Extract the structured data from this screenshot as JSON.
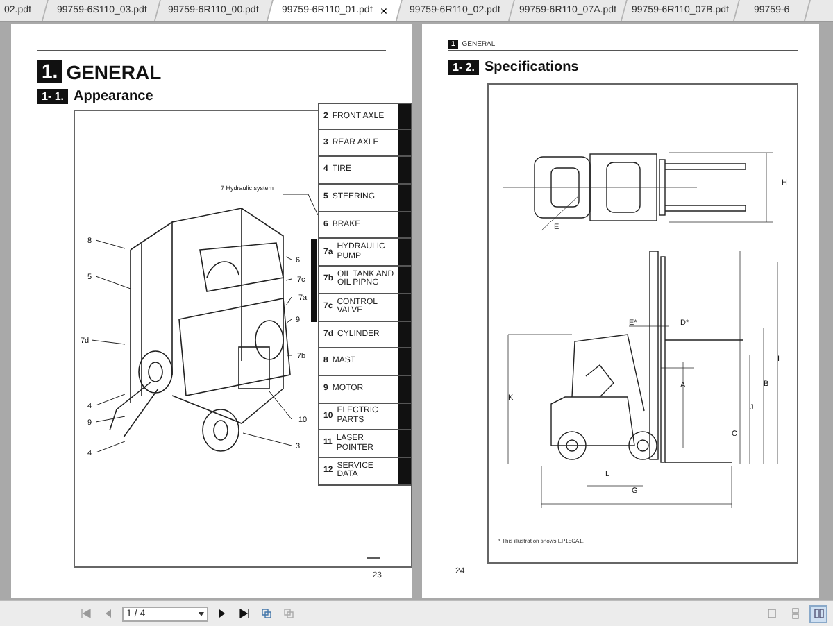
{
  "tabs": [
    {
      "label": "02.pdf",
      "selected": false,
      "closable": false
    },
    {
      "label": "99759-6S110_03.pdf",
      "selected": false,
      "closable": false
    },
    {
      "label": "99759-6R110_00.pdf",
      "selected": false,
      "closable": false
    },
    {
      "label": "99759-6R110_01.pdf",
      "selected": true,
      "closable": true
    },
    {
      "label": "99759-6R110_02.pdf",
      "selected": false,
      "closable": false
    },
    {
      "label": "99759-6R110_07A.pdf",
      "selected": false,
      "closable": false
    },
    {
      "label": "99759-6R110_07B.pdf",
      "selected": false,
      "closable": false
    },
    {
      "label": "99759-6",
      "selected": false,
      "closable": false
    }
  ],
  "tab_close": "×",
  "left_page": {
    "chapter": {
      "number": "1.",
      "title": "GENERAL"
    },
    "section": {
      "number": "1- 1.",
      "title": "Appearance"
    },
    "figure": {
      "system_label": "7 Hydraulic system",
      "callouts": [
        "8",
        "5",
        "7d",
        "4",
        "9",
        "4",
        "6",
        "7c",
        "7a",
        "9",
        "7b",
        "10",
        "3"
      ]
    },
    "index_tabs": [
      {
        "number": "2",
        "label": "FRONT AXLE",
        "marked": false
      },
      {
        "number": "3",
        "label": "REAR AXLE",
        "marked": false
      },
      {
        "number": "4",
        "label": "TIRE",
        "marked": false
      },
      {
        "number": "5",
        "label": "STEERING",
        "marked": false
      },
      {
        "number": "6",
        "label": "BRAKE",
        "marked": false
      },
      {
        "number": "7a",
        "label": "HYDRAULIC PUMP",
        "marked": true
      },
      {
        "number": "7b",
        "label": "OIL TANK AND OIL PIPNG",
        "marked": true
      },
      {
        "number": "7c",
        "label": "CONTROL VALVE",
        "marked": true
      },
      {
        "number": "7d",
        "label": "CYLINDER",
        "marked": false
      },
      {
        "number": "8",
        "label": "MAST",
        "marked": false
      },
      {
        "number": "9",
        "label": "MOTOR",
        "marked": false
      },
      {
        "number": "10",
        "label": "ELECTRIC PARTS",
        "marked": false
      },
      {
        "number": "11",
        "label": "LASER POINTER",
        "marked": false
      },
      {
        "number": "12",
        "label": "SERVICE DATA",
        "marked": false
      }
    ],
    "page_number": "23"
  },
  "right_page": {
    "header": {
      "number": "1",
      "title": "GENERAL"
    },
    "section": {
      "number": "1- 2.",
      "title": "Specifications"
    },
    "figure": {
      "dimension_labels": [
        "H",
        "E",
        "E*",
        "D*",
        "A",
        "K",
        "J",
        "B",
        "I",
        "C",
        "L",
        "G"
      ],
      "footnote": "* This illustration shows EP15CA1."
    },
    "page_number": "24"
  },
  "toolbar": {
    "page_field": "1 / 4",
    "view_modes": [
      {
        "selected": false
      },
      {
        "selected": false
      },
      {
        "selected": true
      }
    ]
  }
}
